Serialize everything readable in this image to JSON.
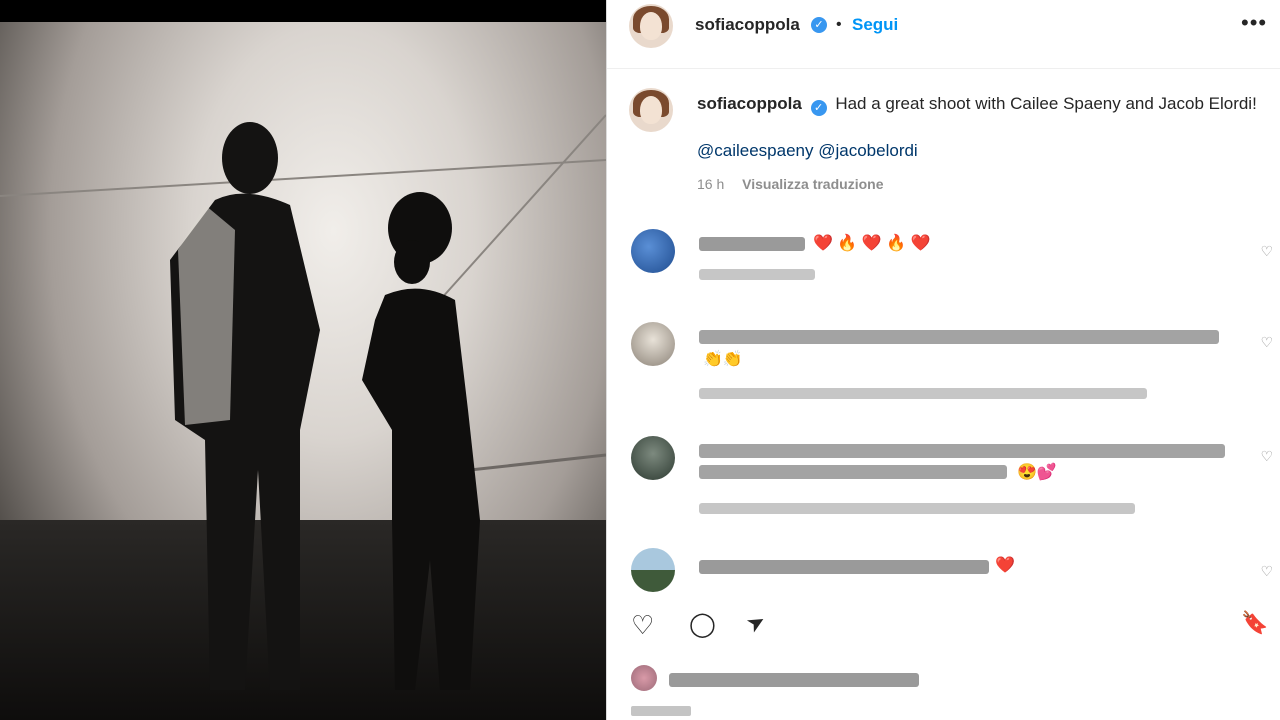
{
  "post": {
    "username": "sofiacoppola",
    "follow_label": "Segui",
    "separator": "•",
    "more_icon": "more-icon",
    "caption": "Had a great shoot with Cailee Spaeny and Jacob Elordi!",
    "mentions": [
      "@caileespaeny",
      "@jacobelordi"
    ],
    "time": "16 h",
    "translate_label": "Visualizza traduzione"
  },
  "comments_emojis": {
    "c1": "❤️ 🔥 ❤️ 🔥 ❤️",
    "c2": "👏👏",
    "c3": "😍💕",
    "c4": "❤️"
  },
  "icons": {
    "heart": "♡",
    "comment": "◯",
    "share": "➤",
    "bookmark": "🔖",
    "verified": "✓"
  },
  "colors": {
    "accent": "#0095f6",
    "verified": "#3897f0",
    "mention": "#00376b"
  }
}
